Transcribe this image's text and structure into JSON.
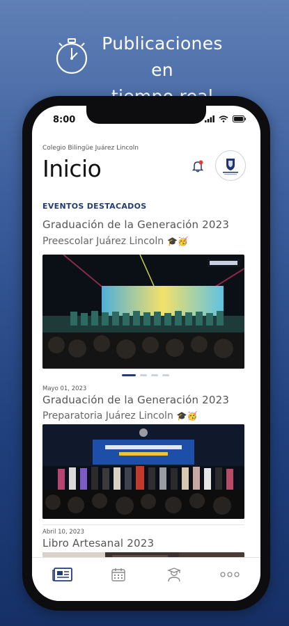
{
  "promo": {
    "line1": "Publicaciones en",
    "line2": "tiempo real"
  },
  "status_bar": {
    "time": "8:00"
  },
  "header": {
    "school_name": "Colegio Bilingüe Juárez Lincoln",
    "title": "Inicio"
  },
  "featured": {
    "section_label": "EVENTOS DESTACADOS",
    "title": "Graduación de la Generación 2023",
    "subtitle": "Preescolar Juárez Lincoln",
    "emoji": "🎓🥳",
    "carousel": {
      "count": 4,
      "active": 0
    }
  },
  "posts": [
    {
      "date": "Mayo 01, 2023",
      "title": "Graduación de la Generación 2023",
      "subtitle": "Preparatoria Juárez Lincoln",
      "emoji": "🎓🥳"
    },
    {
      "date": "Abril 10, 2023",
      "title": "Libro Artesanal 2023"
    }
  ],
  "tabs": [
    {
      "icon": "newspaper-icon",
      "active": true
    },
    {
      "icon": "calendar-icon",
      "active": false
    },
    {
      "icon": "graduate-icon",
      "active": false
    },
    {
      "icon": "more-icon",
      "active": false
    }
  ],
  "colors": {
    "accent": "#233b77",
    "background_top": "#5f7fb6",
    "background_bottom": "#163066"
  }
}
